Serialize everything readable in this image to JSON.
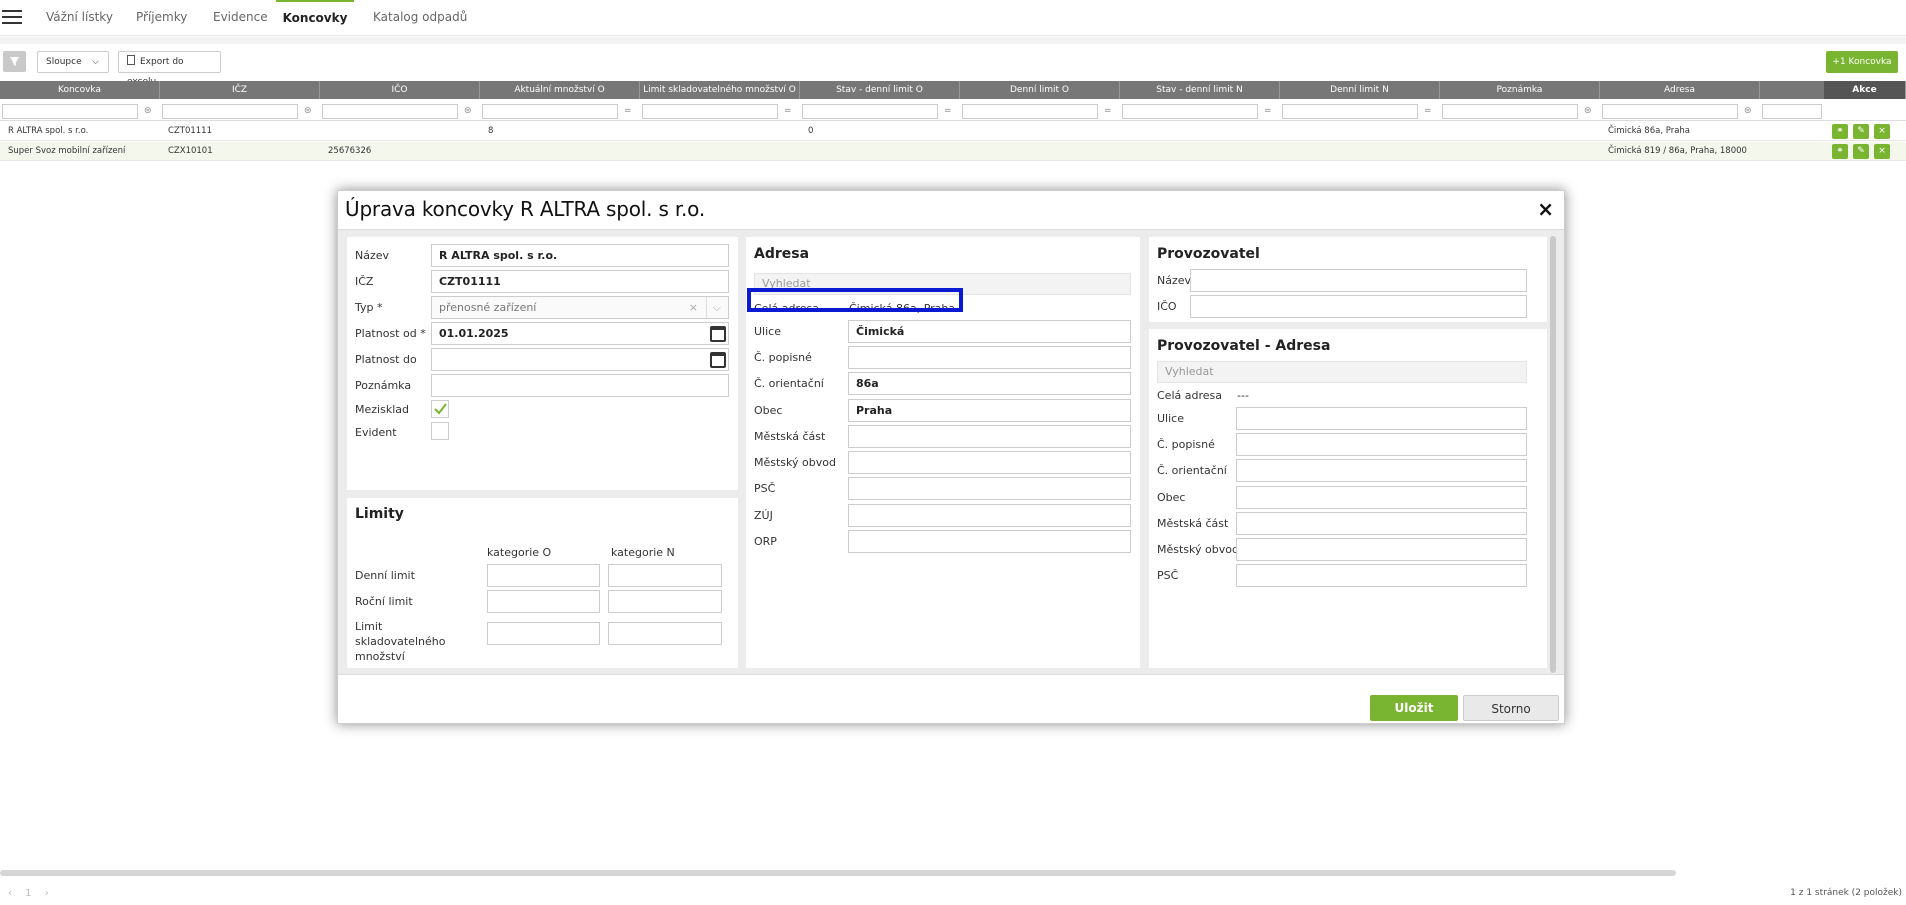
{
  "nav": {
    "tabs": [
      {
        "label": "Vážní lístky"
      },
      {
        "label": "Příjemky"
      },
      {
        "label": "Evidence"
      },
      {
        "label": "Koncovky"
      },
      {
        "label": "Katalog odpadů"
      }
    ]
  },
  "toolbar": {
    "columns_label": "Sloupce",
    "export_label": "Export do excelu",
    "add_label": "+1 Koncovka"
  },
  "table": {
    "columns": [
      "Koncovka",
      "IČZ",
      "IČO",
      "Aktuální množství O",
      "Limit skladovatelného množství O",
      "Stav - denní limit O",
      "Denní limit O",
      "Stav - denní limit N",
      "Denní limit N",
      "Poznámka",
      "Adresa",
      "Akce"
    ],
    "rows": [
      {
        "koncovka": "R ALTRA spol. s r.o.",
        "icz": "CZT01111",
        "ico": "",
        "aktualni": "8",
        "stav_o": "0",
        "adresa": "Čimická 86a, Praha"
      },
      {
        "koncovka": "Super Svoz mobilní zařízení",
        "icz": "CZX10101",
        "ico": "25676326",
        "aktualni": "",
        "stav_o": "",
        "adresa": "Čimická 819 / 86a, Praha, 18000"
      }
    ]
  },
  "modal": {
    "title": "Úprava koncovky R ALTRA spol. s r.o.",
    "close_icon": "×",
    "general": {
      "nazev_label": "Název",
      "nazev_value": "R ALTRA spol. s r.o.",
      "icz_label": "IČZ",
      "icz_value": "CZT01111",
      "typ_label": "Typ *",
      "typ_value": "přenosné zařízení",
      "platnost_od_label": "Platnost od *",
      "platnost_od_value": "01.01.2025",
      "platnost_do_label": "Platnost do",
      "platnost_do_value": "",
      "poznamka_label": "Poznámka",
      "mezisklad_label": "Mezisklad",
      "mezisklad_checked": true,
      "evident_label": "Evident",
      "evident_checked": false
    },
    "limity": {
      "title": "Limity",
      "col_o": "kategorie O",
      "col_n": "kategorie N",
      "denni": "Denní limit",
      "rocni": "Roční limit",
      "sklad": "Limit skladovatelného množství"
    },
    "adresa": {
      "title": "Adresa",
      "search_placeholder": "Vyhledat",
      "cela_label": "Celá adresa",
      "cela_value": "Čimická 86a, Praha",
      "ulice_label": "Ulice",
      "ulice_value": "Čimická",
      "popisne_label": "Č. popisné",
      "orientacni_label": "Č. orientační",
      "orientacni_value": "86a",
      "obec_label": "Obec",
      "obec_value": "Praha",
      "mestska_cast_label": "Městská část",
      "obvod_label": "Městský obvod",
      "psc_label": "PSČ",
      "zuj_label": "ZÚJ",
      "orp_label": "ORP"
    },
    "provozovatel": {
      "title": "Provozovatel",
      "nazev_label": "Název",
      "ico_label": "IČO"
    },
    "prov_adresa": {
      "title": "Provozovatel - Adresa",
      "search_placeholder": "Vyhledat",
      "cela_label": "Celá adresa",
      "cela_value": "---",
      "ulice_label": "Ulice",
      "popisne_label": "Č. popisné",
      "orientacni_label": "Č. orientační",
      "obec_label": "Obec",
      "mestska_cast_label": "Městská část",
      "obvod_label": "Městský obvod",
      "psc_label": "PSČ"
    },
    "save_label": "Uložit",
    "cancel_label": "Storno"
  },
  "pager": {
    "info": "1 z 1 stránek (2 položek)"
  },
  "colors": {
    "accent": "#79b530",
    "highlight": "#0a19d2",
    "header": "#777777"
  }
}
